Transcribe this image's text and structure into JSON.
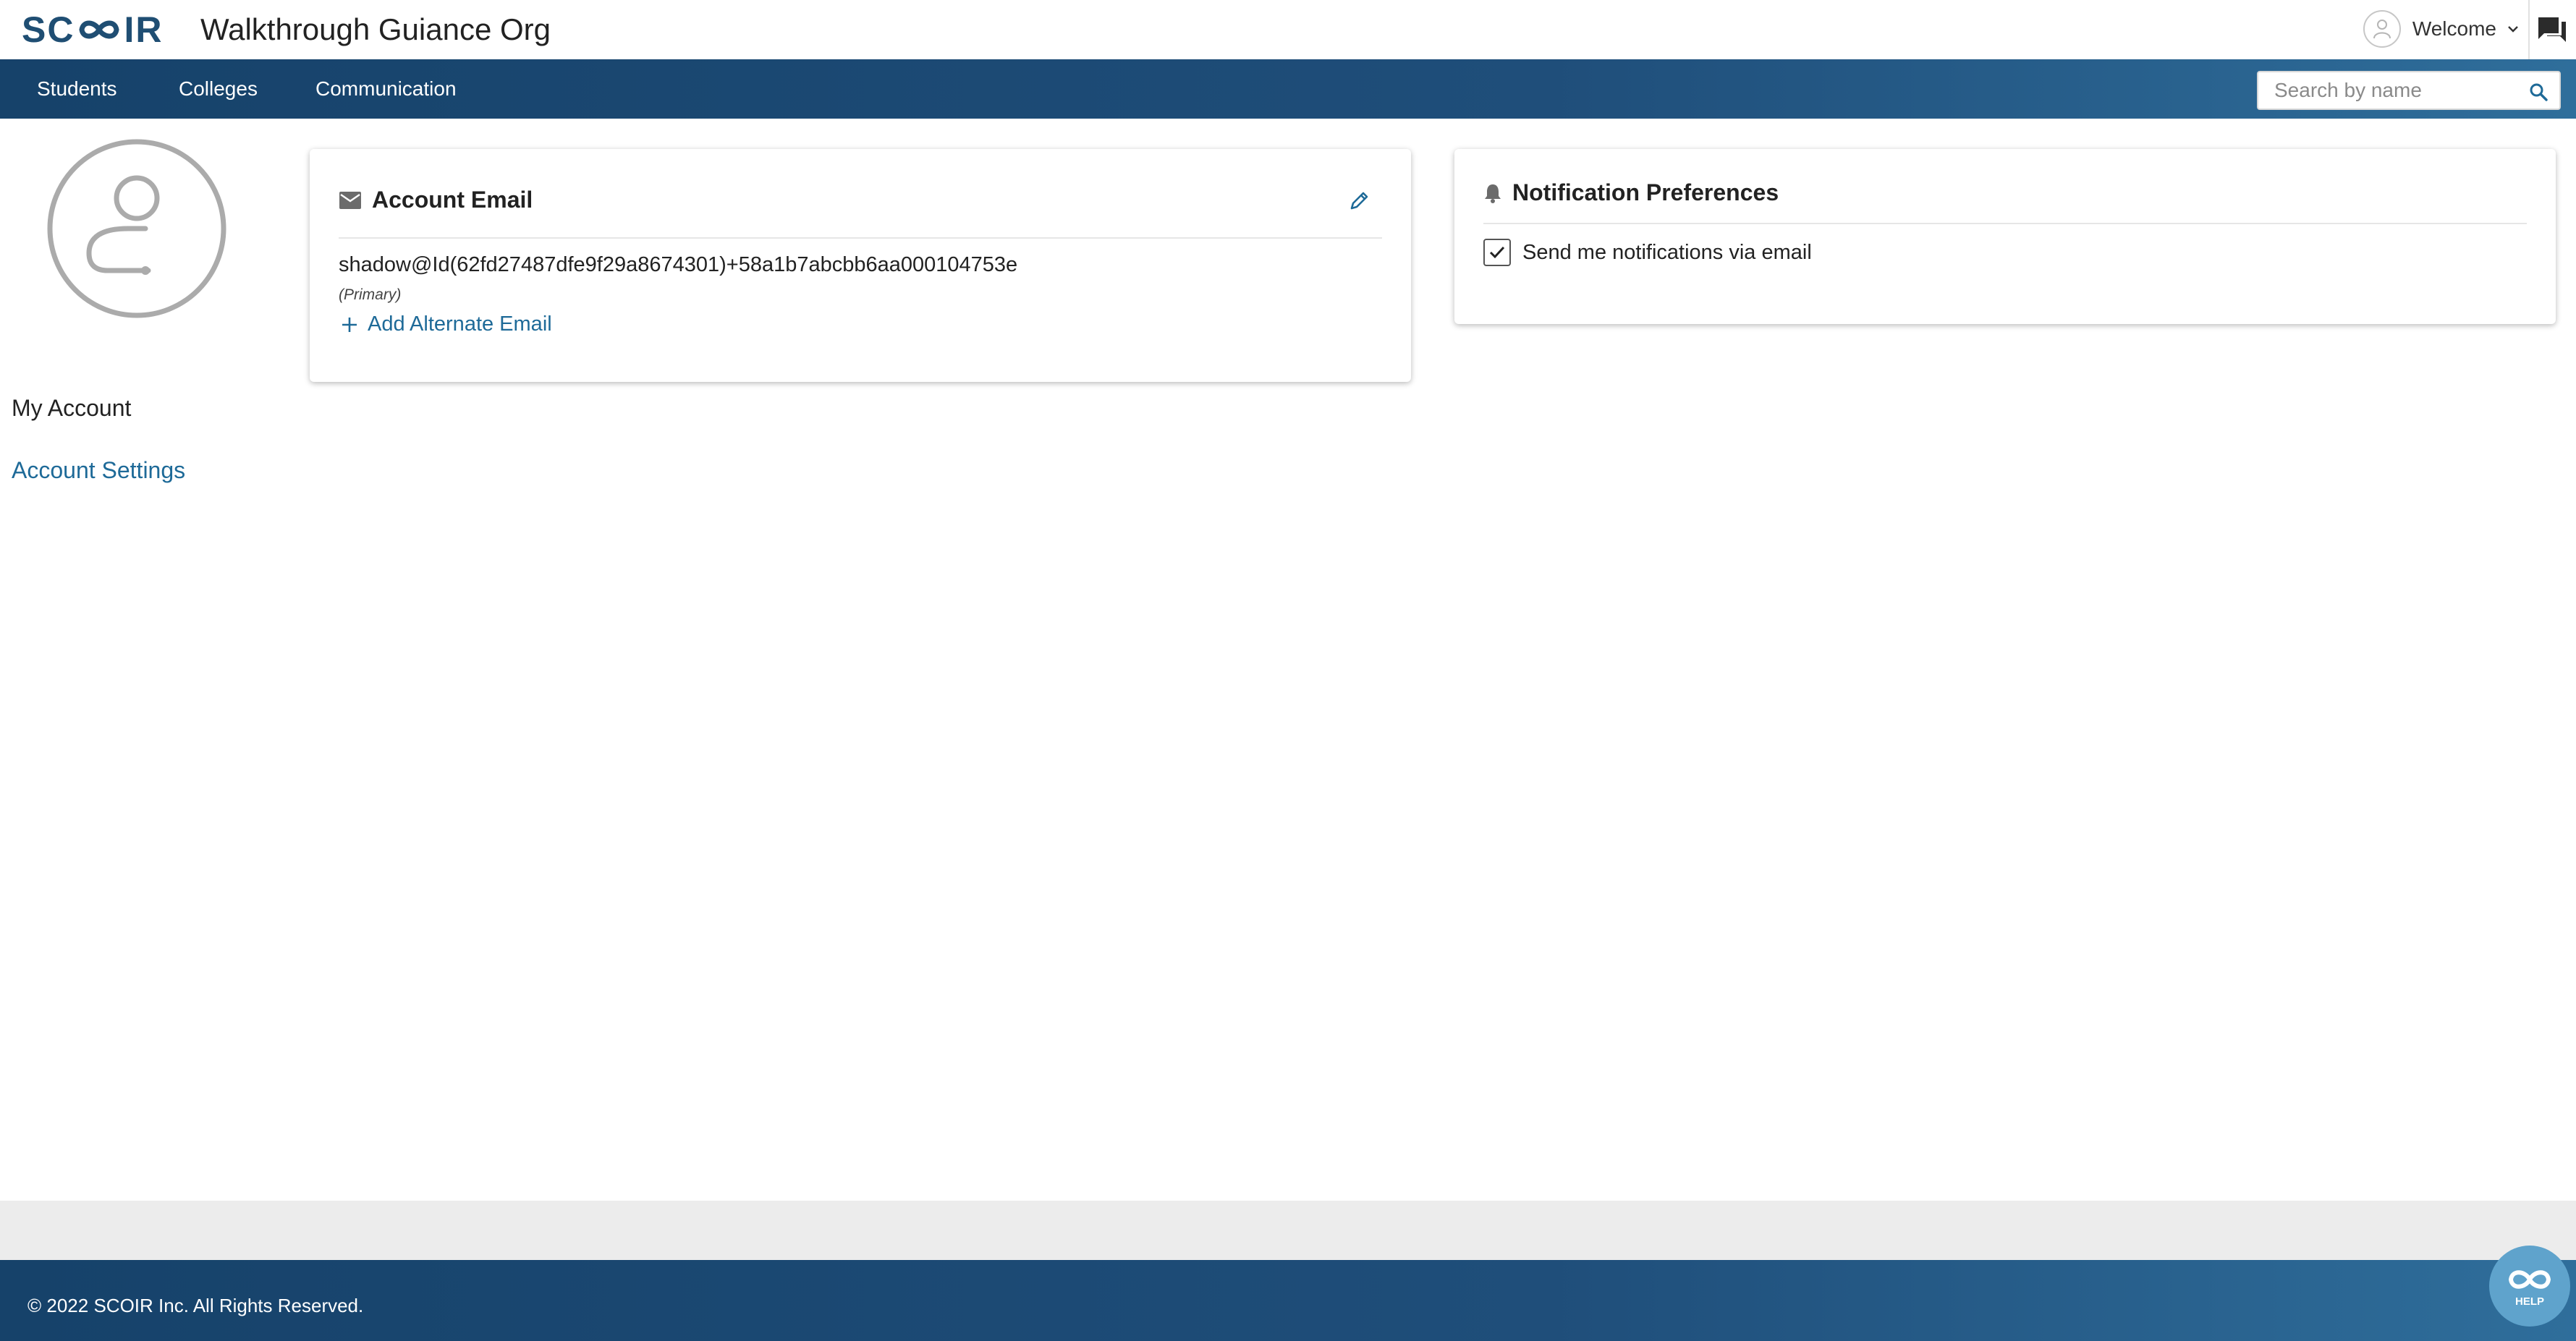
{
  "header": {
    "logo_text_left": "SC",
    "logo_text_right": "IR",
    "org_title": "Walkthrough Guiance Org",
    "welcome_label": "Welcome"
  },
  "nav": {
    "items": [
      {
        "label": "Students"
      },
      {
        "label": "Colleges"
      },
      {
        "label": "Communication"
      }
    ],
    "search_placeholder": "Search by name"
  },
  "sidebar": {
    "section_title": "My Account",
    "settings_link": "Account Settings"
  },
  "account_email": {
    "title": "Account Email",
    "email": "shadow@Id(62fd27487dfe9f29a8674301)+58a1b7abcbb6aa000104753e",
    "primary_label": "(Primary)",
    "add_alternate_label": "Add Alternate Email"
  },
  "notifications": {
    "title": "Notification Preferences",
    "email_option_label": "Send me notifications via email",
    "email_option_checked": true
  },
  "footer": {
    "copyright": "© 2022 SCOIR Inc. All Rights Reserved.",
    "help_label": "HELP"
  },
  "colors": {
    "brand_navy": "#1f4e73",
    "link_blue": "#1e6a98",
    "help_button": "#5fa3cc"
  }
}
